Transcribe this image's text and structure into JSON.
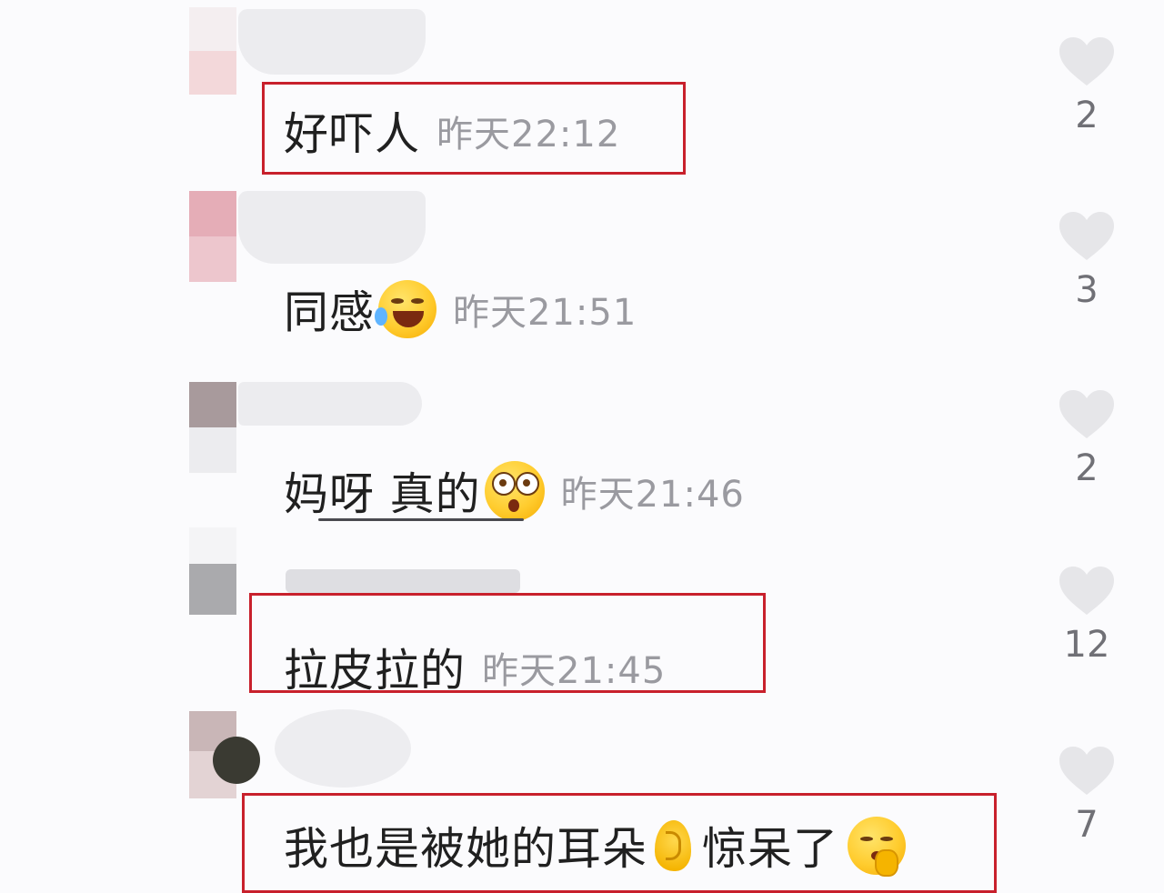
{
  "comments": [
    {
      "text": "好吓人",
      "time": "昨天22:12",
      "likes": "2"
    },
    {
      "text": "同感",
      "time": "昨天21:51",
      "likes": "3",
      "emoji": "laughing-crying-emoji"
    },
    {
      "text": "妈呀 真的",
      "time": "昨天21:46",
      "likes": "2",
      "emoji": "shocked-face-emoji"
    },
    {
      "text": "拉皮拉的",
      "time": "昨天21:45",
      "likes": "12"
    },
    {
      "text_before": "我也是被她的耳朵",
      "text_after": "惊呆了",
      "likes": "7",
      "icons": [
        "ear-emoji",
        "shushing-face-emoji"
      ]
    }
  ],
  "colors": {
    "highlight_box": "#c8202c",
    "heart": "#e6e6e9",
    "text": "#202020",
    "timestamp": "#9a9aa0"
  }
}
